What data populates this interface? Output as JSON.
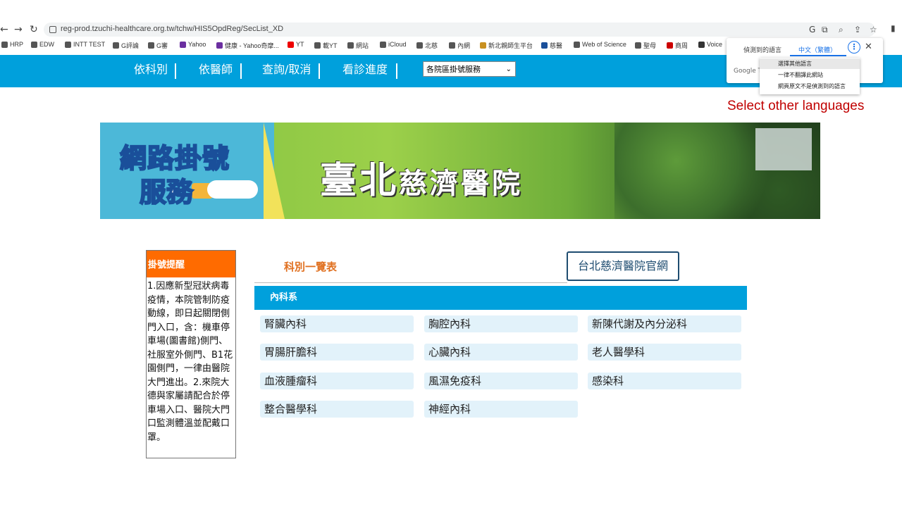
{
  "browser": {
    "url": "reg-prod.tzuchi-healthcare.org.tw/tchw/HIS5OpdReg/SecList_XD",
    "bookmarks": [
      "HRP",
      "EDW",
      "INTT TEST",
      "G評論",
      "G審",
      "Yahoo",
      "健康 - Yahoo奇摩...",
      "YT",
      "載YT",
      "網站",
      "iCloud",
      "北慈",
      "內網",
      "新北親師生平台",
      "慈醫",
      "Web of Science",
      "聖母",
      "商周",
      "Voice"
    ]
  },
  "nav": {
    "items": [
      "依科別",
      "依醫師",
      "查詢/取消",
      "看診進度"
    ],
    "select_value": "各院區掛號服務"
  },
  "translate": {
    "tab_detected": "偵測到的語言",
    "tab_target": "中文（繁體）",
    "google_label": "Google Tr",
    "menu": [
      "選擇其他語言",
      "一律不翻譯此網站",
      "網頁原文不是偵測到的語言"
    ]
  },
  "annotation": "Select other languages",
  "banner": {
    "line1": "網路掛號",
    "line2": "服務",
    "title_big": "臺北",
    "title_small": "慈濟醫院"
  },
  "notice": {
    "title": "掛號提醒",
    "body": "1.因應新型冠狀病毒疫情，本院管制防疫動線，即日起關閉側門入口，含：機車停車場(圖書館)側門、社服室外側門、B1花園側門，一律由醫院大門進出。2.來院大德與家屬請配合於停車場入口、醫院大門口監測體溫並配戴口罩。"
  },
  "main": {
    "list_title": "科別一覽表",
    "official_link": "台北慈濟醫院官網",
    "category": "內科系",
    "departments": [
      "腎臟內科",
      "胸腔內科",
      "新陳代謝及內分泌科",
      "胃腸肝膽科",
      "心臟內科",
      "老人醫學科",
      "血液腫瘤科",
      "風濕免疫科",
      "感染科",
      "整合醫學科",
      "神經內科"
    ]
  },
  "colors": {
    "nav_bg": "#00a0dc",
    "notice_head": "#ff6b00",
    "list_title": "#e07020",
    "dept_bg": "#e2f2fa",
    "annotation": "#c00000"
  }
}
